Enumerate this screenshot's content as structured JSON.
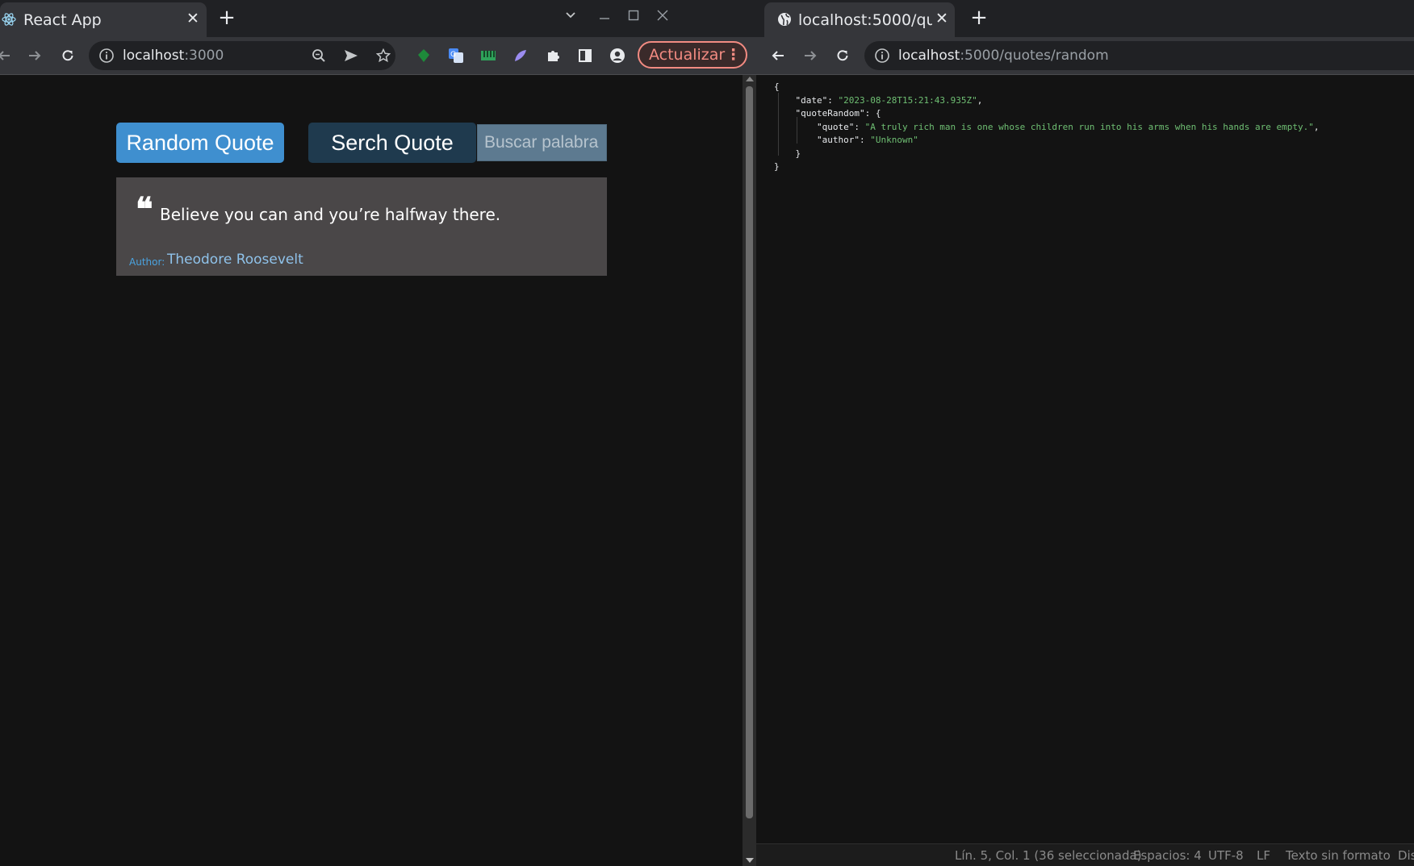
{
  "left_window": {
    "tab": {
      "title": "React App"
    },
    "toolbar": {
      "url_host": "localhost",
      "url_path": ":3000",
      "update_label": "Actualizar"
    },
    "app": {
      "random_button": "Random Quote",
      "search_button": "Serch Quote",
      "search_placeholder": "Buscar palabra",
      "quote": {
        "mark": "❝",
        "text": "Believe you can and you’re halfway there.",
        "author_label": "Author:",
        "author": "Theodore Roosevelt"
      }
    }
  },
  "right_window": {
    "tab": {
      "title": "localhost:5000/quotes/random"
    },
    "toolbar": {
      "url_host": "localhost",
      "url_path": ":5000/quotes/random"
    },
    "json": {
      "open": "{",
      "date_key": "\"date\"",
      "date_value": "\"2023-08-28T15:21:43.935Z\"",
      "quote_random_key": "\"quoteRandom\"",
      "quote_key": "\"quote\"",
      "quote_value": "\"A truly rich man is one whose children run into his arms when his hands are empty.\"",
      "author_key": "\"author\"",
      "author_value": "\"Unknown\"",
      "inner_close": "}",
      "close": "}"
    },
    "statusbar": {
      "position": "Lín. 5, Col. 1 (36 seleccionada)",
      "spaces": "Espacios: 4",
      "encoding": "UTF-8",
      "line_ending": "LF",
      "format": "Texto sin formato",
      "extra": "Dis"
    }
  }
}
